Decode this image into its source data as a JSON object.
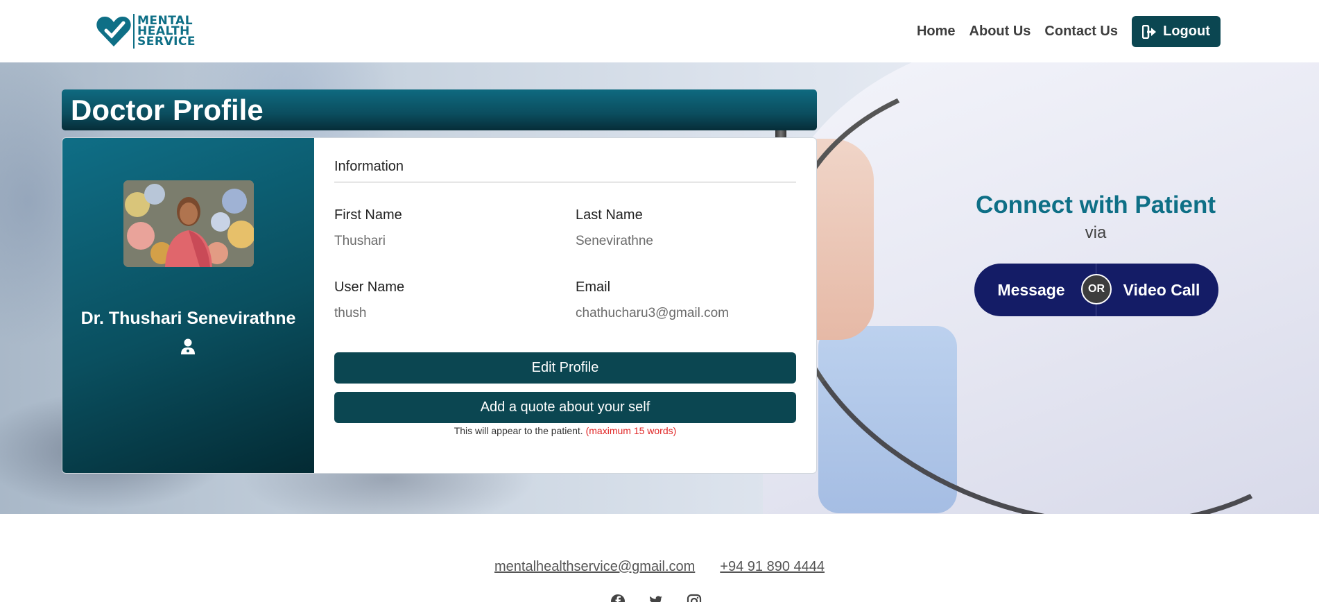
{
  "header": {
    "logo_lines": [
      "MENTAL",
      "HEALTH",
      "SERVICE"
    ],
    "nav": [
      "Home",
      "About Us",
      "Contact Us"
    ],
    "logout_label": "Logout"
  },
  "page": {
    "title": "Doctor Profile"
  },
  "profile": {
    "name": "Dr. Thushari Senevirathne",
    "info_heading": "Information",
    "fields": {
      "first_name_label": "First Name",
      "first_name_value": "Thushari",
      "last_name_label": "Last Name",
      "last_name_value": "Senevirathne",
      "user_name_label": "User Name",
      "user_name_value": "thush",
      "email_label": "Email",
      "email_value": "chathucharu3@gmail.com"
    },
    "edit_button": "Edit Profile",
    "quote_button": "Add a quote about your self",
    "hint_text": "This will appear to the patient.",
    "hint_limit": "(maximum 15 words)"
  },
  "connect": {
    "heading": "Connect with Patient",
    "via": "via",
    "message_label": "Message",
    "or_label": "OR",
    "video_label": "Video Call"
  },
  "footer": {
    "email": "mentalhealthservice@gmail.com",
    "phone": "+94 91 890 4444",
    "social_icons": [
      "facebook-icon",
      "twitter-icon",
      "instagram-icon"
    ]
  },
  "colors": {
    "brand_teal": "#0e6f86",
    "button_dark": "#0b4651",
    "pill_navy": "#141c66",
    "warning_red": "#e02424"
  }
}
